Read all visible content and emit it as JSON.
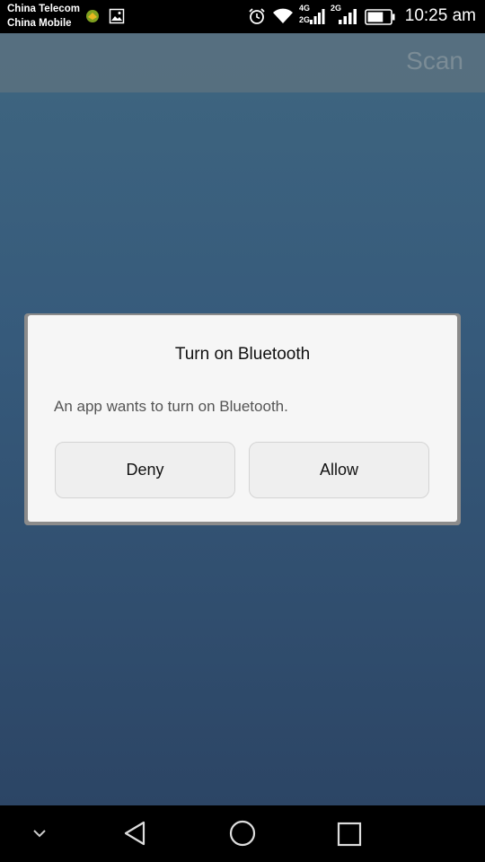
{
  "status_bar": {
    "carrier_1": "China Telecom",
    "carrier_2": "China Mobile",
    "network_4g": "4G",
    "network_2g_small": "2G",
    "network_2g": "2G",
    "time": "10:25 am",
    "battery_level": 0.7
  },
  "toolbar": {
    "scan_label": "Scan"
  },
  "dialog": {
    "title": "Turn on Bluetooth",
    "message": "An app wants to turn on Bluetooth.",
    "deny_label": "Deny",
    "allow_label": "Allow"
  },
  "icons": {
    "status": [
      "app-notification-icon",
      "image-icon",
      "alarm-icon",
      "wifi-icon",
      "signal-icon",
      "battery-icon"
    ],
    "nav": [
      "chevron-down-icon",
      "back-icon",
      "home-icon",
      "recents-icon"
    ]
  },
  "colors": {
    "background_top": "#3f6680",
    "background_bottom": "#2c4565",
    "toolbar": "#57707f",
    "dialog": "#f6f6f6"
  }
}
